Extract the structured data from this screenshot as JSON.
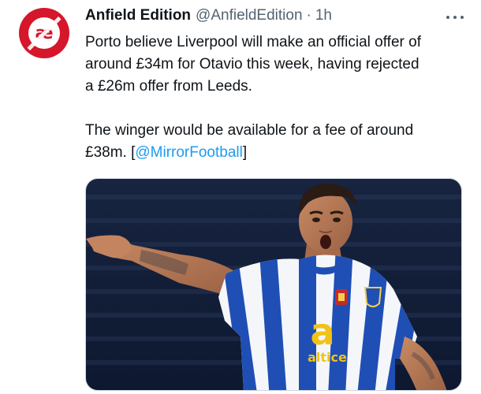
{
  "tweet": {
    "avatar_glyph": "æ",
    "display_name": "Anfield Edition",
    "handle": "@AnfieldEdition",
    "separator": "·",
    "timestamp": "1h",
    "text_lines": [
      "Porto believe Liverpool will make an official offer of",
      "around £34m for Otavio this week, having rejected",
      "a £26m offer from Leeds."
    ],
    "text_line_2a": "The winger would be available for a fee of around",
    "text_line_2b_prefix": "£38m. [",
    "mention": "@MirrorFootball",
    "text_line_2b_suffix": "]",
    "media": {
      "sponsor_text": "altice"
    }
  },
  "colors": {
    "brand_red": "#d5162b",
    "link_blue": "#1d9bf0",
    "secondary_text": "#536471",
    "porto_blue": "#1f4fb5"
  },
  "icons": {
    "more": "more-horizontal-icon",
    "avatar": "anfield-edition-logo"
  }
}
